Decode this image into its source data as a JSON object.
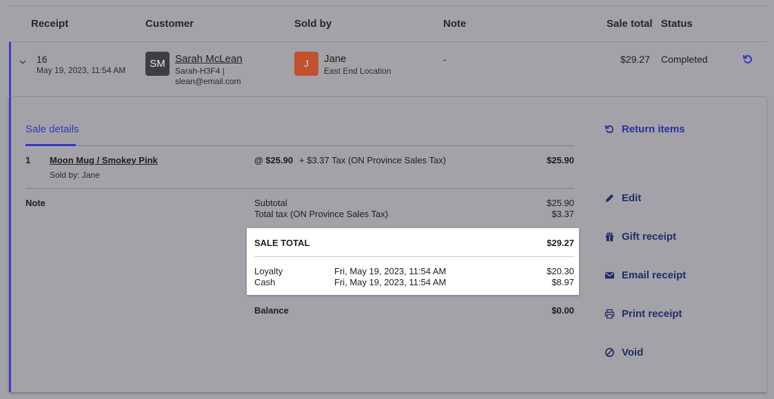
{
  "table": {
    "headers": {
      "receipt": "Receipt",
      "customer": "Customer",
      "sold_by": "Sold by",
      "note": "Note",
      "sale_total": "Sale total",
      "status": "Status"
    },
    "row": {
      "receipt_number": "16",
      "date": "May 19, 2023, 11:54 AM",
      "customer": {
        "initials": "SM",
        "name": "Sarah McLean",
        "code": "Sarah-H3F4 |",
        "email": "slean@email.com"
      },
      "sold_by": {
        "initial": "J",
        "name": "Jane",
        "location": "East End Location"
      },
      "note": "-",
      "sale_total": "$29.27",
      "status": "Completed"
    }
  },
  "details": {
    "tab_label": "Sale details",
    "item": {
      "quantity": "1",
      "name": "Moon Mug / Smokey Pink",
      "sold_by": "Sold by: Jane",
      "unit_price": "@ $25.90",
      "tax": "+ $3.37 Tax (ON Province Sales Tax)",
      "amount": "$25.90"
    },
    "note_label": "Note",
    "subtotal_label": "Subtotal",
    "subtotal_value": "$25.90",
    "tax_label": "Total tax (ON Province Sales Tax)",
    "tax_value": "$3.37",
    "sale_total_label": "SALE TOTAL",
    "sale_total_value": "$29.27",
    "payments": [
      {
        "method": "Loyalty",
        "date": "Fri, May 19, 2023, 11:54 AM",
        "amount": "$20.30"
      },
      {
        "method": "Cash",
        "date": "Fri, May 19, 2023, 11:54 AM",
        "amount": "$8.97"
      }
    ],
    "balance_label": "Balance",
    "balance_value": "$0.00"
  },
  "actions": {
    "return_items": "Return items",
    "edit": "Edit",
    "gift_receipt": "Gift receipt",
    "email_receipt": "Email receipt",
    "print_receipt": "Print receipt",
    "void": "Void"
  },
  "colors": {
    "accent": "#3636b8",
    "action_text": "#1f2d66",
    "avatar_customer": "#3e3e42",
    "avatar_seller": "#c0522f",
    "overlay_background": "#a3a2a8"
  }
}
